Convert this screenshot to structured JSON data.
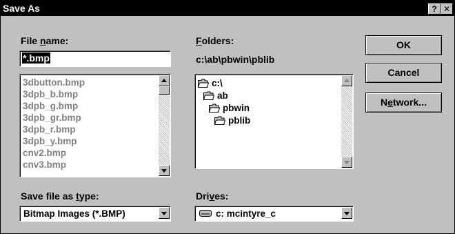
{
  "window": {
    "title": "Save As",
    "help_btn": "?",
    "close_btn": "✕"
  },
  "file_name": {
    "label_before": "File ",
    "label_mnemonic": "n",
    "label_after": "ame:",
    "value": "*.bmp"
  },
  "file_list": {
    "items": [
      "3dbutton.bmp",
      "3dpb_b.bmp",
      "3dpb_g.bmp",
      "3dpb_gr.bmp",
      "3dpb_r.bmp",
      "3dpb_y.bmp",
      "cnv2.bmp",
      "cnv3.bmp"
    ]
  },
  "folders": {
    "label_mnemonic": "F",
    "label_after": "olders:",
    "current_path": "c:\\ab\\pbwin\\pblib",
    "items": [
      {
        "label": "c:\\",
        "icon": "open-folder-icon"
      },
      {
        "label": "ab",
        "icon": "open-folder-icon"
      },
      {
        "label": "pbwin",
        "icon": "open-folder-icon"
      },
      {
        "label": "pblib",
        "icon": "open-folder-icon"
      }
    ]
  },
  "save_type": {
    "label_before": "Save file as ",
    "label_mnemonic": "t",
    "label_after": "ype:",
    "value": "Bitmap Images (*.BMP)"
  },
  "drives": {
    "label_before": "Dri",
    "label_mnemonic": "v",
    "label_after": "es:",
    "value": "c: mcintyre_c",
    "icon": "hard-drive-icon"
  },
  "buttons": {
    "ok": "OK",
    "cancel": "Cancel",
    "network_before": "N",
    "network_mnemonic": "e",
    "network_after": "twork..."
  },
  "colors": {
    "face": "#c0c0c0",
    "titlebar": "#000000",
    "disabled_text": "#808080"
  }
}
